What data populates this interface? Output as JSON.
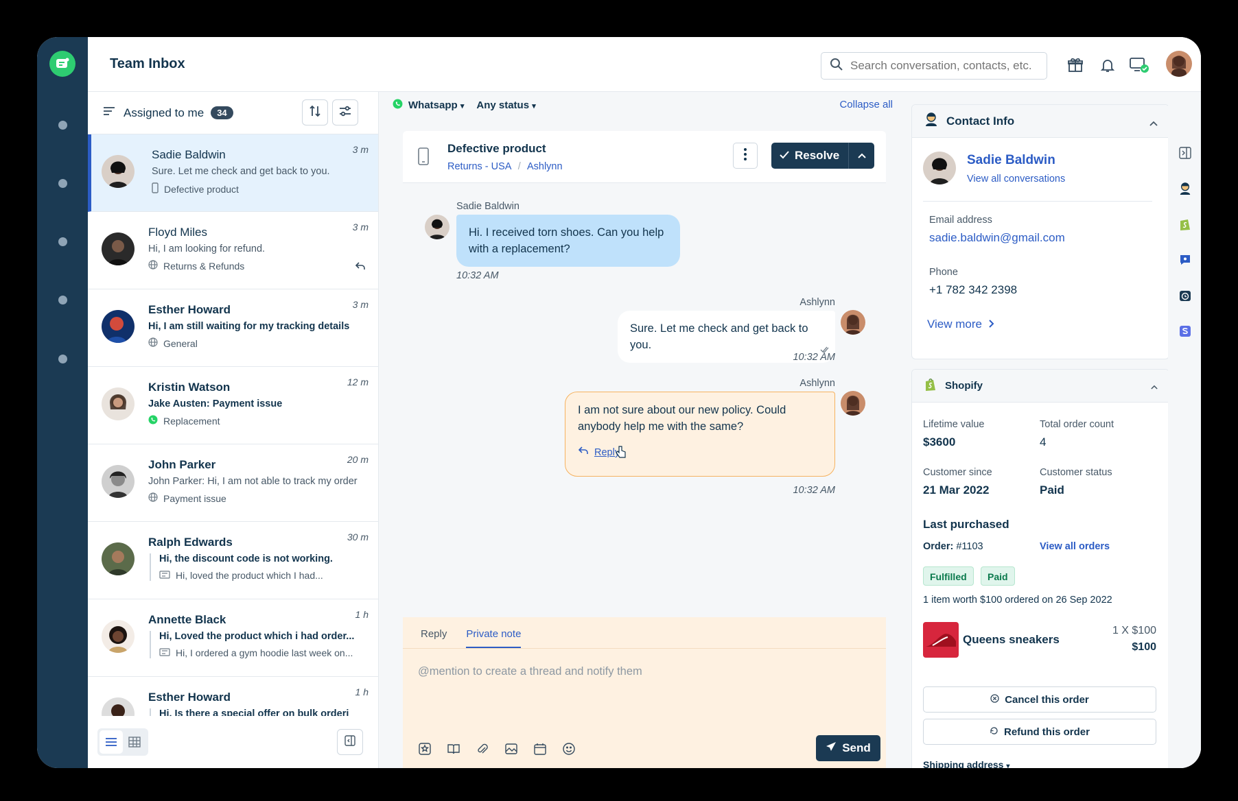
{
  "header": {
    "title": "Team Inbox",
    "search_placeholder": "Search conversation, contacts, etc."
  },
  "list": {
    "filter_label": "Assigned to me",
    "count": "34",
    "conversations": [
      {
        "name": "Sadie Baldwin",
        "preview": "Sure. Let me check and get back to you.",
        "tag": "Defective product",
        "time": "3 m"
      },
      {
        "name": "Floyd Miles",
        "preview": "Hi, I am looking for refund.",
        "tag": "Returns & Refunds",
        "time": "3 m"
      },
      {
        "name": "Esther Howard",
        "preview": "Hi, I am still waiting for my tracking details",
        "tag": "General",
        "time": "3 m"
      },
      {
        "name": "Kristin Watson",
        "preview": "Jake Austen: Payment issue",
        "tag": "Replacement",
        "time": "12 m"
      },
      {
        "name": "John Parker",
        "preview": "John Parker: Hi, I am not able to track my order",
        "tag": "Payment issue",
        "time": "20 m"
      },
      {
        "name": "Ralph Edwards",
        "preview": "Hi, the discount code is not working.",
        "tag": "Hi, loved the product which I had...",
        "time": "30 m"
      },
      {
        "name": "Annette Black",
        "preview": "Hi, Loved the product which i had order...",
        "tag": "Hi, I ordered a gym hoodie last week on...",
        "time": "1 h"
      },
      {
        "name": "Esther Howard",
        "preview": "Hi, Is there a special offer on bulk orderi",
        "time": "1 h"
      }
    ]
  },
  "chat": {
    "channel": "Whatsapp",
    "status": "Any status",
    "collapse_all": "Collapse all",
    "title": "Defective product",
    "crumb_group": "Returns - USA",
    "crumb_sep": "/",
    "crumb_agent": "Ashlynn",
    "resolve_label": "Resolve",
    "messages": [
      {
        "sender": "Sadie Baldwin",
        "text": "Hi. I received torn shoes. Can you help with a replacement?",
        "time": "10:32 AM"
      },
      {
        "sender": "Ashlynn",
        "text": "Sure. Let me check and get back to you.",
        "time": "10:32 AM"
      },
      {
        "sender": "Ashlynn",
        "text": "I am not sure about our new policy. Could anybody help me with the same?",
        "reply_label": "Reply",
        "time": "10:32 AM"
      }
    ],
    "composer": {
      "tab_reply": "Reply",
      "tab_note": "Private note",
      "placeholder": "@mention to create a thread and notify them",
      "send_label": "Send"
    }
  },
  "contact": {
    "heading": "Contact Info",
    "name": "Sadie Baldwin",
    "view_all": "View all conversations",
    "email_label": "Email address",
    "email": "sadie.baldwin@gmail.com",
    "phone_label": "Phone",
    "phone": "+1 782 342 2398",
    "view_more": "View more"
  },
  "shopify": {
    "heading": "Shopify",
    "lifetime_label": "Lifetime value",
    "lifetime": "$3600",
    "orders_label": "Total order count",
    "orders": "4",
    "since_label": "Customer since",
    "since": "21 Mar 2022",
    "status_label": "Customer status",
    "status": "Paid",
    "last_purchased": "Last purchased",
    "order_label": "Order:",
    "order_id": "#1103",
    "view_orders": "View all orders",
    "badge_fulfilled": "Fulfilled",
    "badge_paid": "Paid",
    "summary": "1 item worth $100 ordered on 26 Sep 2022",
    "product": "Queens sneakers",
    "qty": "1 X $100",
    "total": "$100",
    "cancel": "Cancel this order",
    "refund": "Refund this order",
    "shipping": "Shipping address"
  },
  "colors": {
    "rail": "#1b3a53",
    "accent": "#2c5cc5",
    "active_row": "#e5f2fd",
    "note_bg": "#fef1e1",
    "customer_bubble": "#bfe1fb",
    "whatsapp": "#25d366"
  }
}
